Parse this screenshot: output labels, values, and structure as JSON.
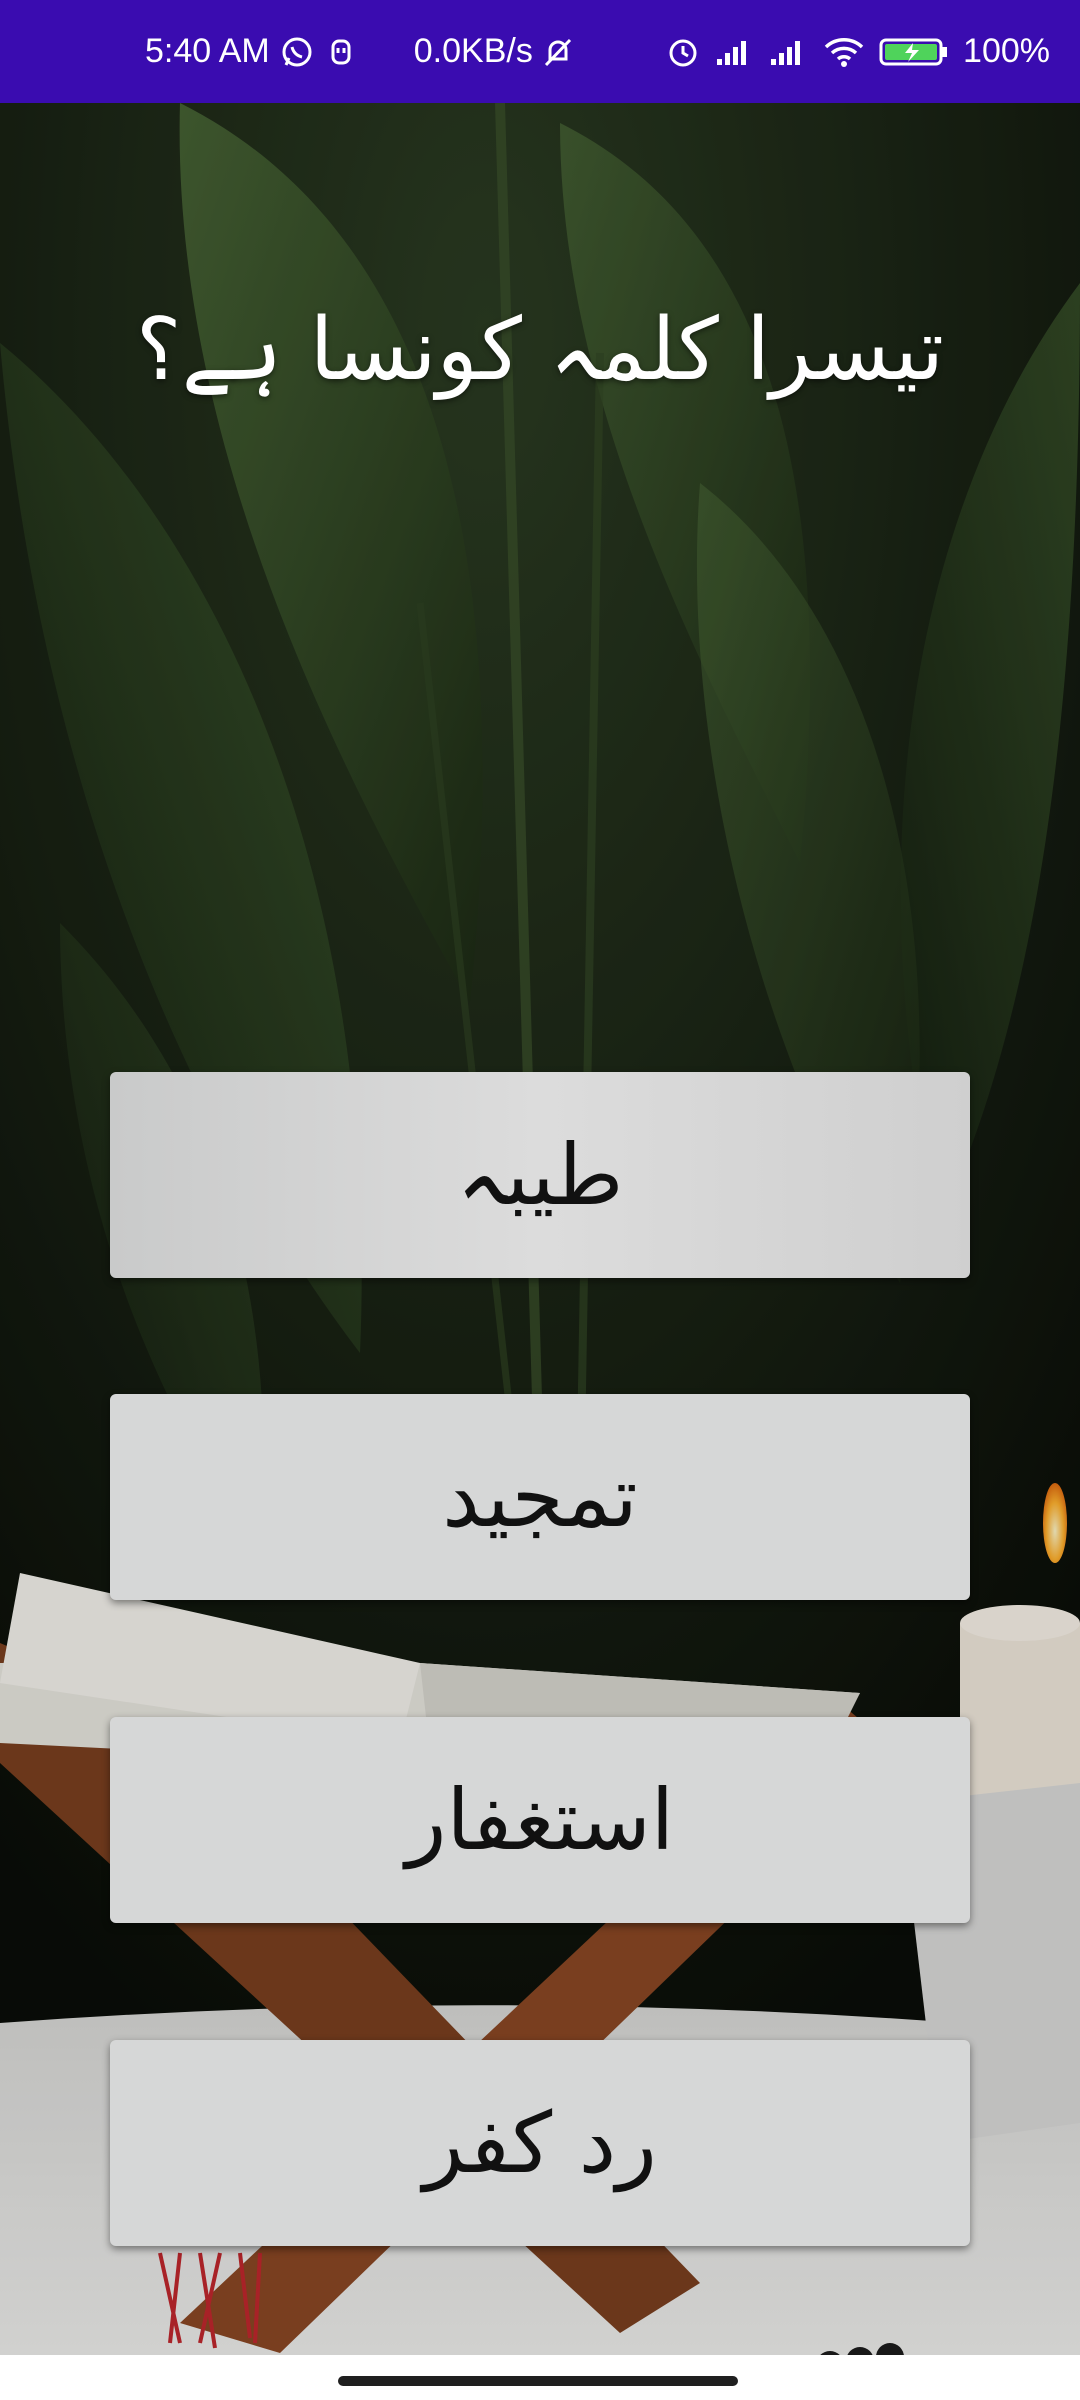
{
  "status_bar": {
    "time": "5:40 AM",
    "net_speed": "0.0KB/s",
    "battery": "100%",
    "icons": [
      "whatsapp-icon",
      "usb-icon",
      "mute-icon",
      "alarm-icon",
      "signal-icon",
      "signal-icon",
      "wifi-icon",
      "battery-charging-icon"
    ],
    "background_color": "#3a0cb0"
  },
  "quiz": {
    "question": "تیسرا کلمہ کونسا ہے؟",
    "options": [
      {
        "label": "طیبہ"
      },
      {
        "label": "تمجید"
      },
      {
        "label": "استغفار"
      },
      {
        "label": "رد کفر"
      }
    ]
  },
  "colors": {
    "button_bg": "#d6d7d7",
    "button_text": "#111111",
    "question_text": "#ffffff"
  }
}
